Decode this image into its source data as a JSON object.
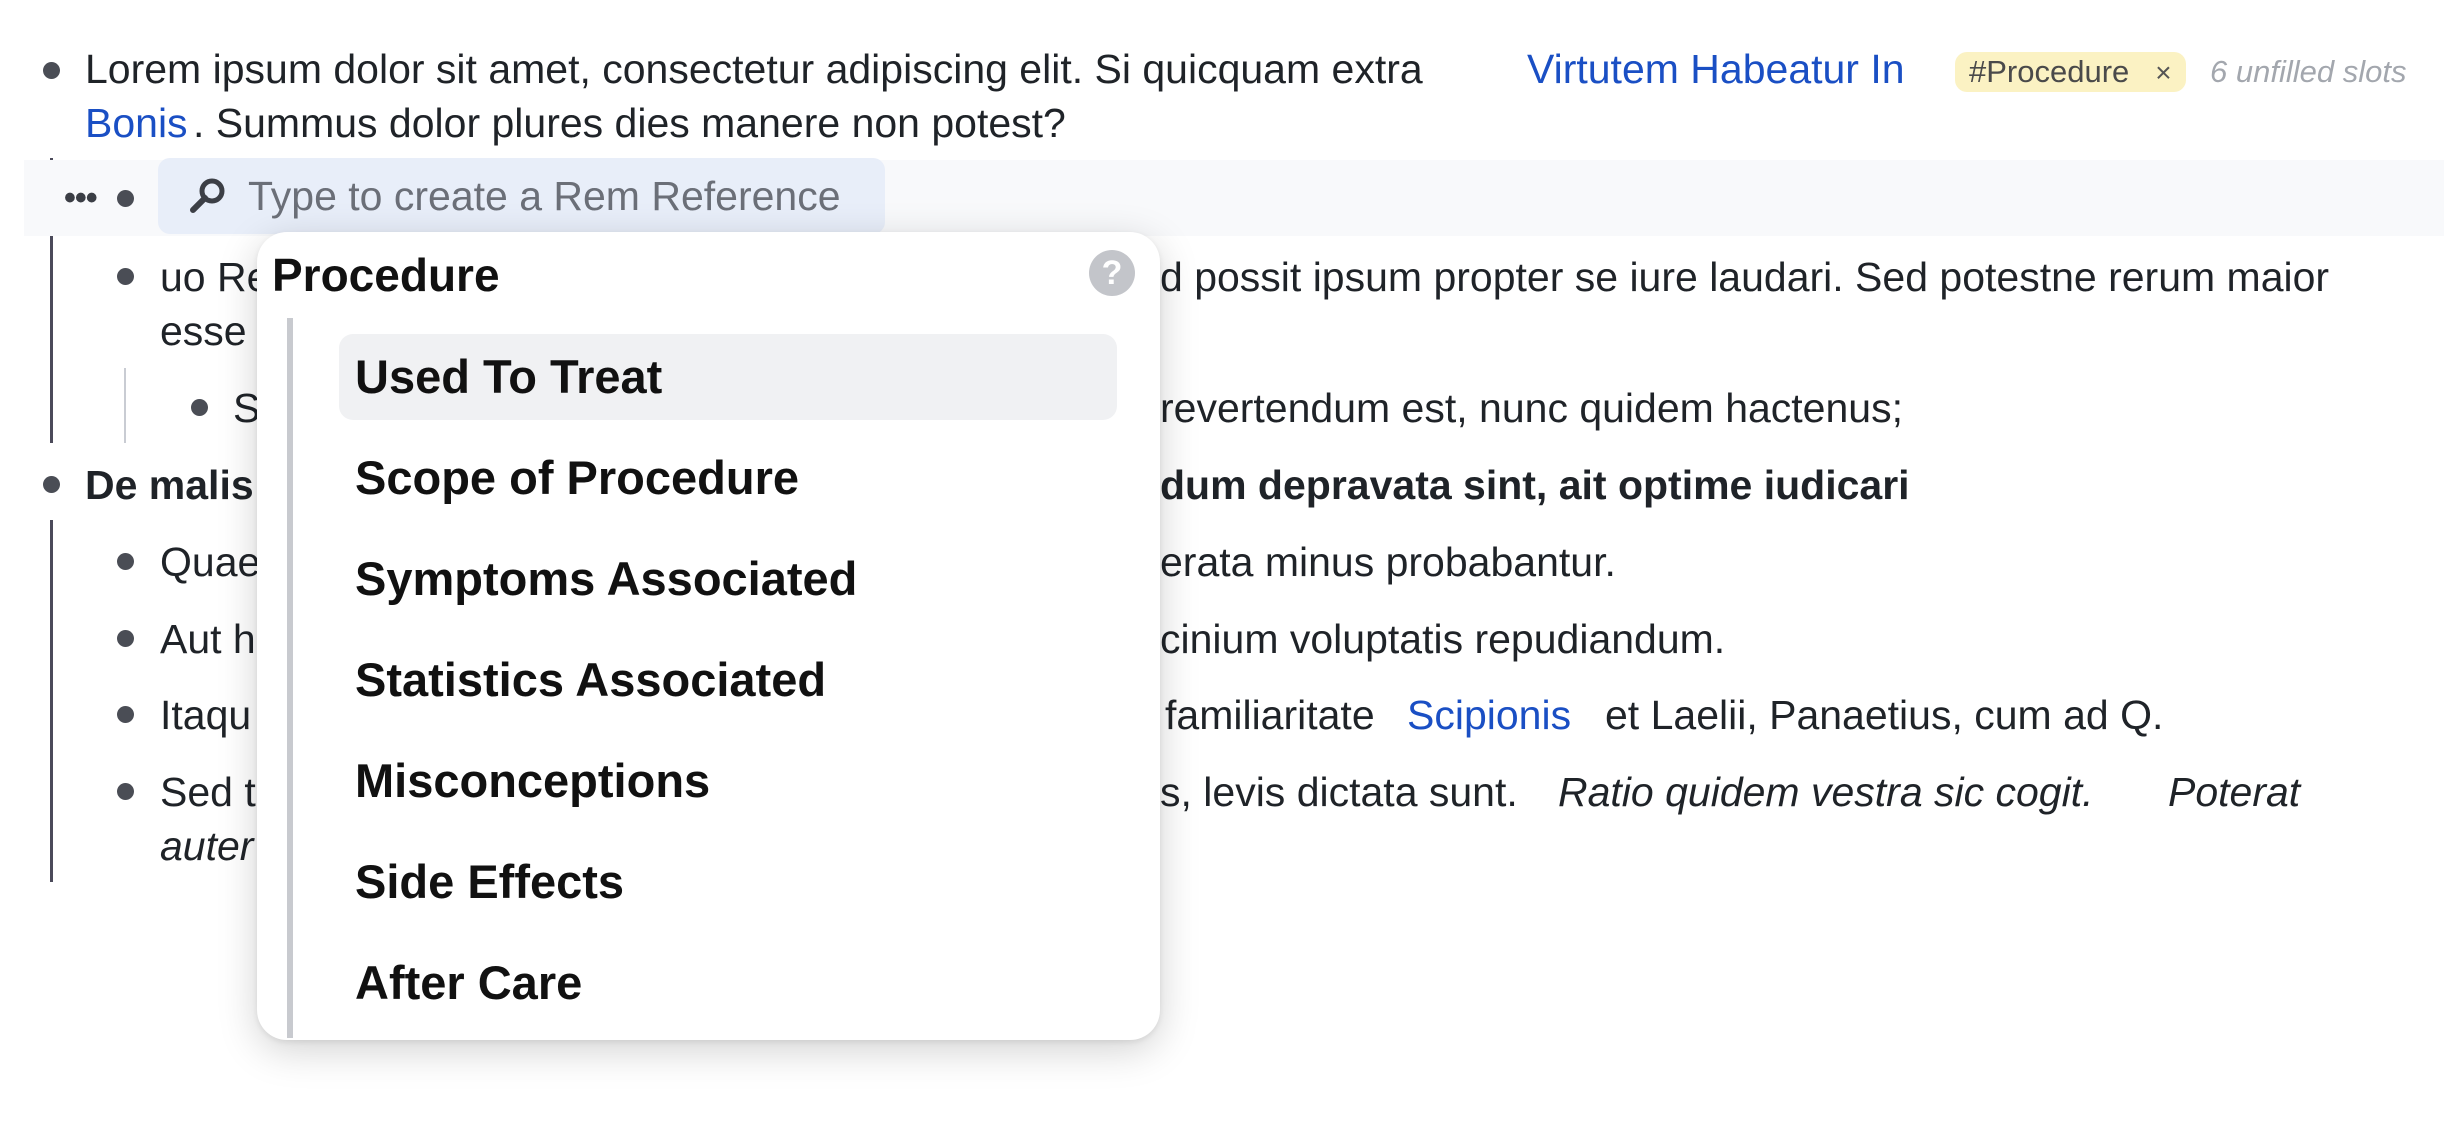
{
  "doc": {
    "line1_text": "Lorem ipsum dolor sit amet, consectetur adipiscing elit. Si quicquam extra",
    "line1_link_a": "Virtutem Habeatur In",
    "line1_link_b": "Bonis",
    "line1_tail": ". Summus dolor plures dies manere non potest?",
    "tag_label": "#Procedure",
    "tag_close": "×",
    "unfilled_slots": "6 unfilled slots",
    "search_placeholder": "Type to create a Rem Reference",
    "more_dots": "•••",
    "row3a_left": "uo Re",
    "row3a_right": "d possit ipsum propter se iure laudari. Sed potestne rerum maior",
    "row3b_left": "esse",
    "row4_left": "S",
    "row4_right": "revertendum est, nunc quidem hactenus;",
    "row5_left": "De malis",
    "row5_right": "dum depravata sint, ait optime iudicari",
    "row6_left": "Quae",
    "row6_right": "erata minus probabantur.",
    "row7_left": "Aut h",
    "row7_right": "cinium voluptatis repudiandum.",
    "row8_left": "Itaqu",
    "row8_mid": "familiaritate",
    "row8_link": "Scipionis",
    "row8_right": "et Laelii, Panaetius, cum ad Q.",
    "row9_left": "Sed t",
    "row9_mid": "s, levis dictata sunt.",
    "row9_italic_a": "Ratio quidem vestra sic cogit.",
    "row9_italic_b": "Poterat",
    "row10_left": "auter"
  },
  "popup": {
    "title": "Procedure",
    "help_glyph": "?",
    "items": [
      {
        "label": "Used To Treat"
      },
      {
        "label": "Scope of Procedure"
      },
      {
        "label": "Symptoms Associated"
      },
      {
        "label": "Statistics Associated"
      },
      {
        "label": "Misconceptions"
      },
      {
        "label": "Side Effects"
      },
      {
        "label": "After Care"
      }
    ]
  },
  "colors": {
    "link": "#1a4fc4",
    "tag_bg": "#fbf2c3",
    "search_bg": "#e8eef9",
    "active_item_bg": "#f0f1f3"
  }
}
